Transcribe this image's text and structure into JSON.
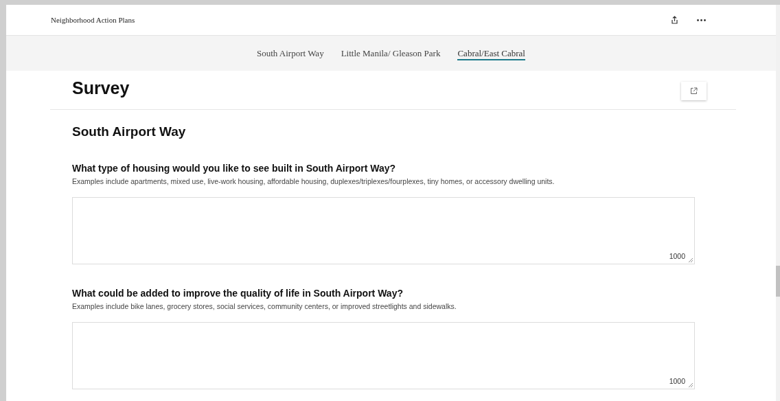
{
  "header": {
    "title": "Neighborhood Action Plans"
  },
  "tabs": [
    {
      "label": "South Airport Way",
      "selected": false
    },
    {
      "label": "Little Manila/ Gleason Park",
      "selected": false
    },
    {
      "label": "Cabral/East Cabral",
      "selected": true
    }
  ],
  "page": {
    "title": "Survey"
  },
  "section": {
    "title": "South Airport Way"
  },
  "questions": [
    {
      "label": "What type of housing would you like to see built in South Airport Way?",
      "hint": "Examples include apartments, mixed use, live-work housing, affordable housing, duplexes/triplexes/fourplexes, tiny homes, or accessory dwelling units.",
      "counter": "1000"
    },
    {
      "label": "What could be added to improve the quality of life in South Airport Way?",
      "hint": "Examples include bike lanes, grocery stores, social services, community centers, or improved streetlights and sidewalks.",
      "counter": "1000"
    }
  ]
}
